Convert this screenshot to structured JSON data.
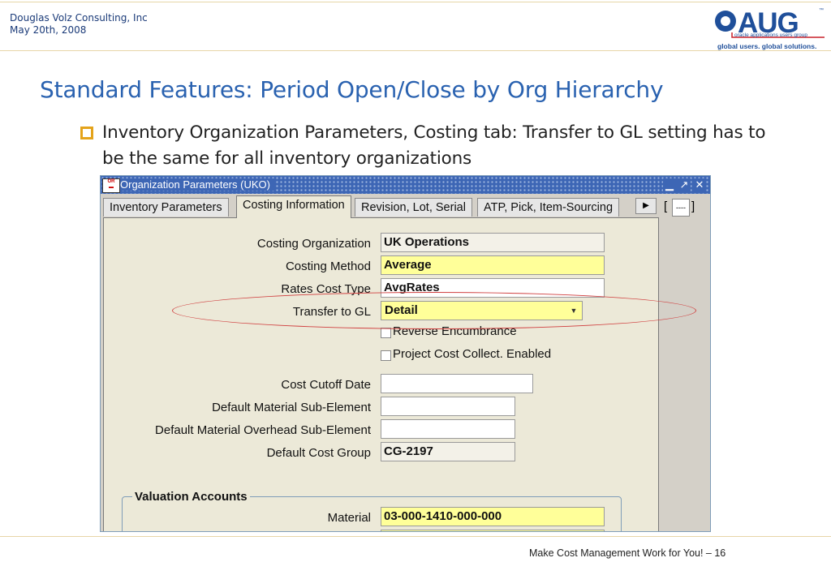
{
  "slide": {
    "company": "Douglas Volz Consulting, Inc",
    "date": "May 20th, 2008",
    "logo": {
      "text": "OAUG",
      "subtitle": "oracle applications users group",
      "tagline": "global users. global solutions.",
      "tm": "™"
    },
    "title": "Standard Features:  Period Open/Close by Org Hierarchy",
    "bullet": "Inventory Organization Parameters, Costing tab:  Transfer to GL setting has to be the same for all inventory organizations",
    "footer": "Make Cost Management Work for You! – 16",
    "colors": {
      "title": "#2a62b0",
      "bullet": "#e4a31b",
      "highlight": "#d04040"
    }
  },
  "window": {
    "title": "Organization Parameters (UKO)",
    "icon": "oracle-icon",
    "controls": [
      "minimize-icon",
      "maximize-icon",
      "close-icon"
    ],
    "tabs": [
      {
        "label": "Inventory Parameters",
        "active": false
      },
      {
        "label": "Costing Information",
        "active": true
      },
      {
        "label": "Revision, Lot, Serial",
        "active": false
      },
      {
        "label": "ATP, Pick, Item-Sourcing",
        "active": false
      }
    ],
    "record_indicator": "[",
    "record_indicator_close": "]",
    "record_value": "----",
    "fields": {
      "costing_org": {
        "label": "Costing Organization",
        "value": "UK Operations"
      },
      "costing_method": {
        "label": "Costing Method",
        "value": "Average"
      },
      "rates_cost_type": {
        "label": "Rates Cost Type",
        "value": "AvgRates"
      },
      "transfer_to_gl": {
        "label": "Transfer to GL",
        "value": "Detail"
      },
      "reverse_encumbrance": {
        "label": "Reverse Encumbrance",
        "checked": false
      },
      "project_cost_collect": {
        "label": "Project Cost Collect. Enabled",
        "checked": false
      },
      "cost_cutoff_date": {
        "label": "Cost Cutoff Date",
        "value": ""
      },
      "default_material_sub_element": {
        "label": "Default Material Sub-Element",
        "value": ""
      },
      "default_material_overhead_sub_element": {
        "label": "Default Material Overhead Sub-Element",
        "value": ""
      },
      "default_cost_group": {
        "label": "Default Cost Group",
        "value": "CG-2197"
      }
    },
    "valuation_accounts": {
      "title": "Valuation Accounts",
      "material": {
        "label": "Material",
        "value": "03-000-1410-000-000"
      }
    }
  }
}
